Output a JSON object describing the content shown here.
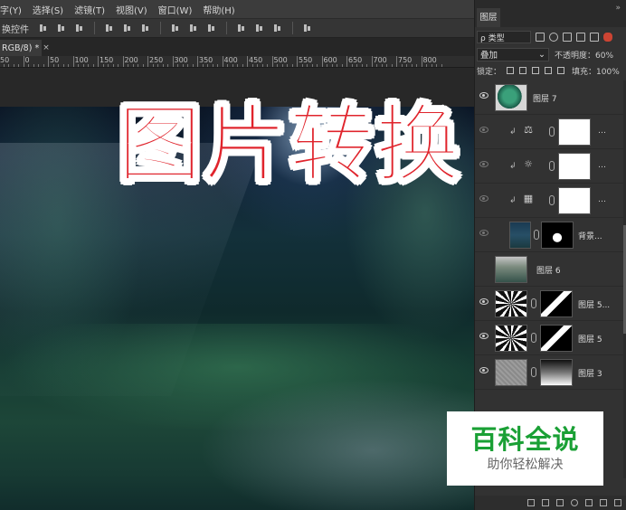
{
  "menu": {
    "items": [
      "字(Y)",
      "选择(S)",
      "滤镜(T)",
      "视图(V)",
      "窗口(W)",
      "帮助(H)"
    ]
  },
  "options_bar": {
    "label": "换控件"
  },
  "document": {
    "tab_title": "RGB/8) *",
    "tab_close": "×"
  },
  "ruler": {
    "labels": [
      "50",
      "0",
      "50",
      "100",
      "150",
      "200",
      "250",
      "300",
      "350",
      "400",
      "450",
      "500",
      "550",
      "600",
      "650",
      "700",
      "750",
      "800"
    ]
  },
  "canvas": {
    "overlay_title": "图片转换"
  },
  "watermark": {
    "main": "百科全说",
    "sub": "助你轻松解决"
  },
  "layers_panel": {
    "tab": "图层",
    "filter_kind": "ρ 类型",
    "blend_mode": "叠加",
    "opacity_label": "不透明度：",
    "opacity_value": "60%",
    "lock_label": "锁定：",
    "fill_label": "填充：",
    "fill_value": "100%",
    "layers": [
      {
        "name": "图层 7",
        "visible": true,
        "thumb": "green-plant"
      },
      {
        "name": "…",
        "visible": false,
        "adjustment_icon": "balance-icon",
        "thumb": "white"
      },
      {
        "name": "…",
        "visible": false,
        "adjustment_icon": "brightness-icon",
        "thumb": "white"
      },
      {
        "name": "…",
        "visible": false,
        "adjustment_icon": "hue-icon",
        "thumb": "white"
      },
      {
        "name": "背景...",
        "visible": false,
        "thumb": "photo"
      },
      {
        "name": "图层 6",
        "visible": false,
        "thumb": "forest"
      },
      {
        "name": "图层 5...",
        "visible": true,
        "thumb": "rays"
      },
      {
        "name": "图层 5",
        "visible": true,
        "thumb": "rays"
      },
      {
        "name": "图层 3",
        "visible": true,
        "thumb": "noise"
      }
    ]
  }
}
